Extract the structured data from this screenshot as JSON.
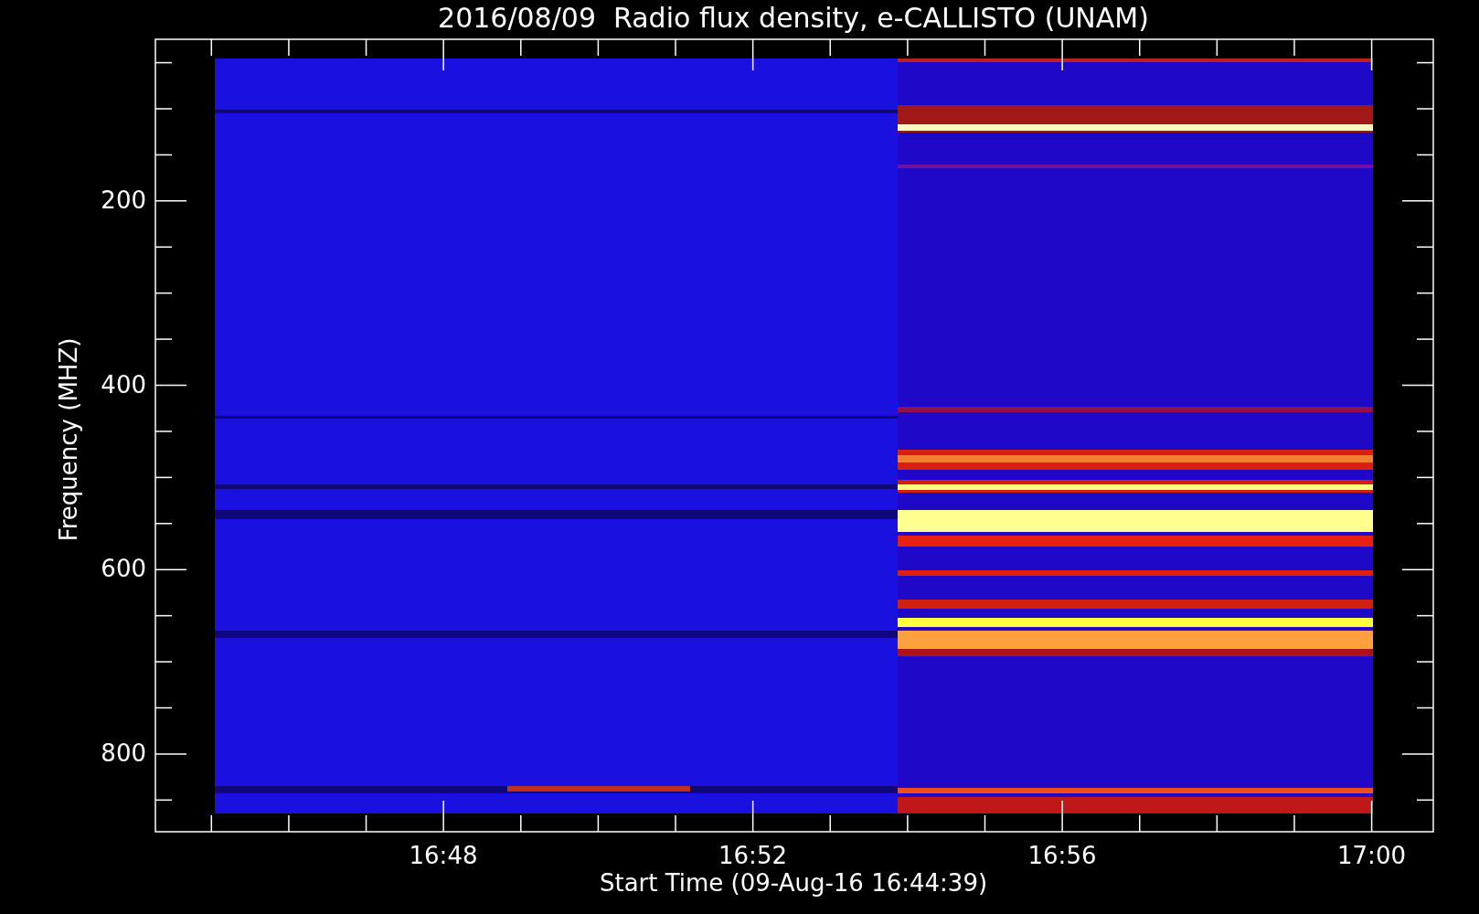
{
  "title": "2016/08/09  Radio flux density, e-CALLISTO (UNAM)",
  "plot": {
    "ylabel": "Frequency (MHZ)",
    "xlabel": "Start Time (09-Aug-16 16:44:39)",
    "yticks": [
      "200",
      "400",
      "600",
      "800"
    ],
    "xticks": [
      "16:48",
      "16:52",
      "16:56",
      "17:00"
    ]
  }
}
